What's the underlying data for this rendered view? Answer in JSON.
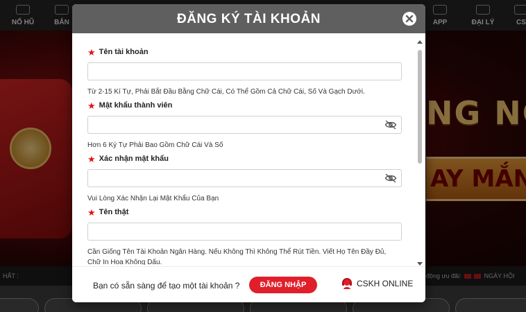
{
  "site": {
    "nav": {
      "no_hu": "NỔ HŨ",
      "ban": "BẮN",
      "app": "APP",
      "dai_ly": "ĐẠI LÝ",
      "cs": "CS"
    },
    "banner": {
      "text_1": "NG NG",
      "text_2": "AY MẮN"
    },
    "ticker": {
      "left": "HẤT :",
      "right_1": "động ưu đãi:",
      "right_2": "NGÀY HỘI"
    }
  },
  "modal": {
    "title": "ĐĂNG KÝ TÀI KHOẢN",
    "fields": [
      {
        "label": "Tên tài khoản",
        "value": "",
        "hint": "Từ 2-15 Kí Tự, Phải Bắt Đầu Bằng Chữ Cái, Có Thể Gồm Cả Chữ Cái, Số Và Gạch Dưới."
      },
      {
        "label": "Mật khẩu thành viên",
        "value": "",
        "hint": "Hơn 6 Ký Tự Phải Bao Gồm Chữ Cái Và Số"
      },
      {
        "label": "Xác nhận mật khẩu",
        "value": "",
        "hint": "Vui Lòng Xác Nhận Lại Mật Khẩu Của Bạn"
      },
      {
        "label": "Tên thật",
        "value": "",
        "hint": "Cần Giống Tên Tài Khoản Ngân Hàng. Nếu Không Thì Không Thể Rút Tiền. Viết Họ Tên Đầy Đủ, Chữ In Hoa Không Dấu."
      }
    ],
    "footer": {
      "prompt": "Bạn có sẵn sàng để tạo một tài khoản ?",
      "login_label": "ĐĂNG NHẬP",
      "support_label": "CSKH ONLINE"
    }
  },
  "colors": {
    "header_bg": "#5f5f5f",
    "required_star": "#e01414",
    "login_button": "#e01f2b"
  },
  "icons": {
    "close": "close-icon",
    "password_toggle": "eye-slash-icon",
    "support": "headset-icon"
  }
}
